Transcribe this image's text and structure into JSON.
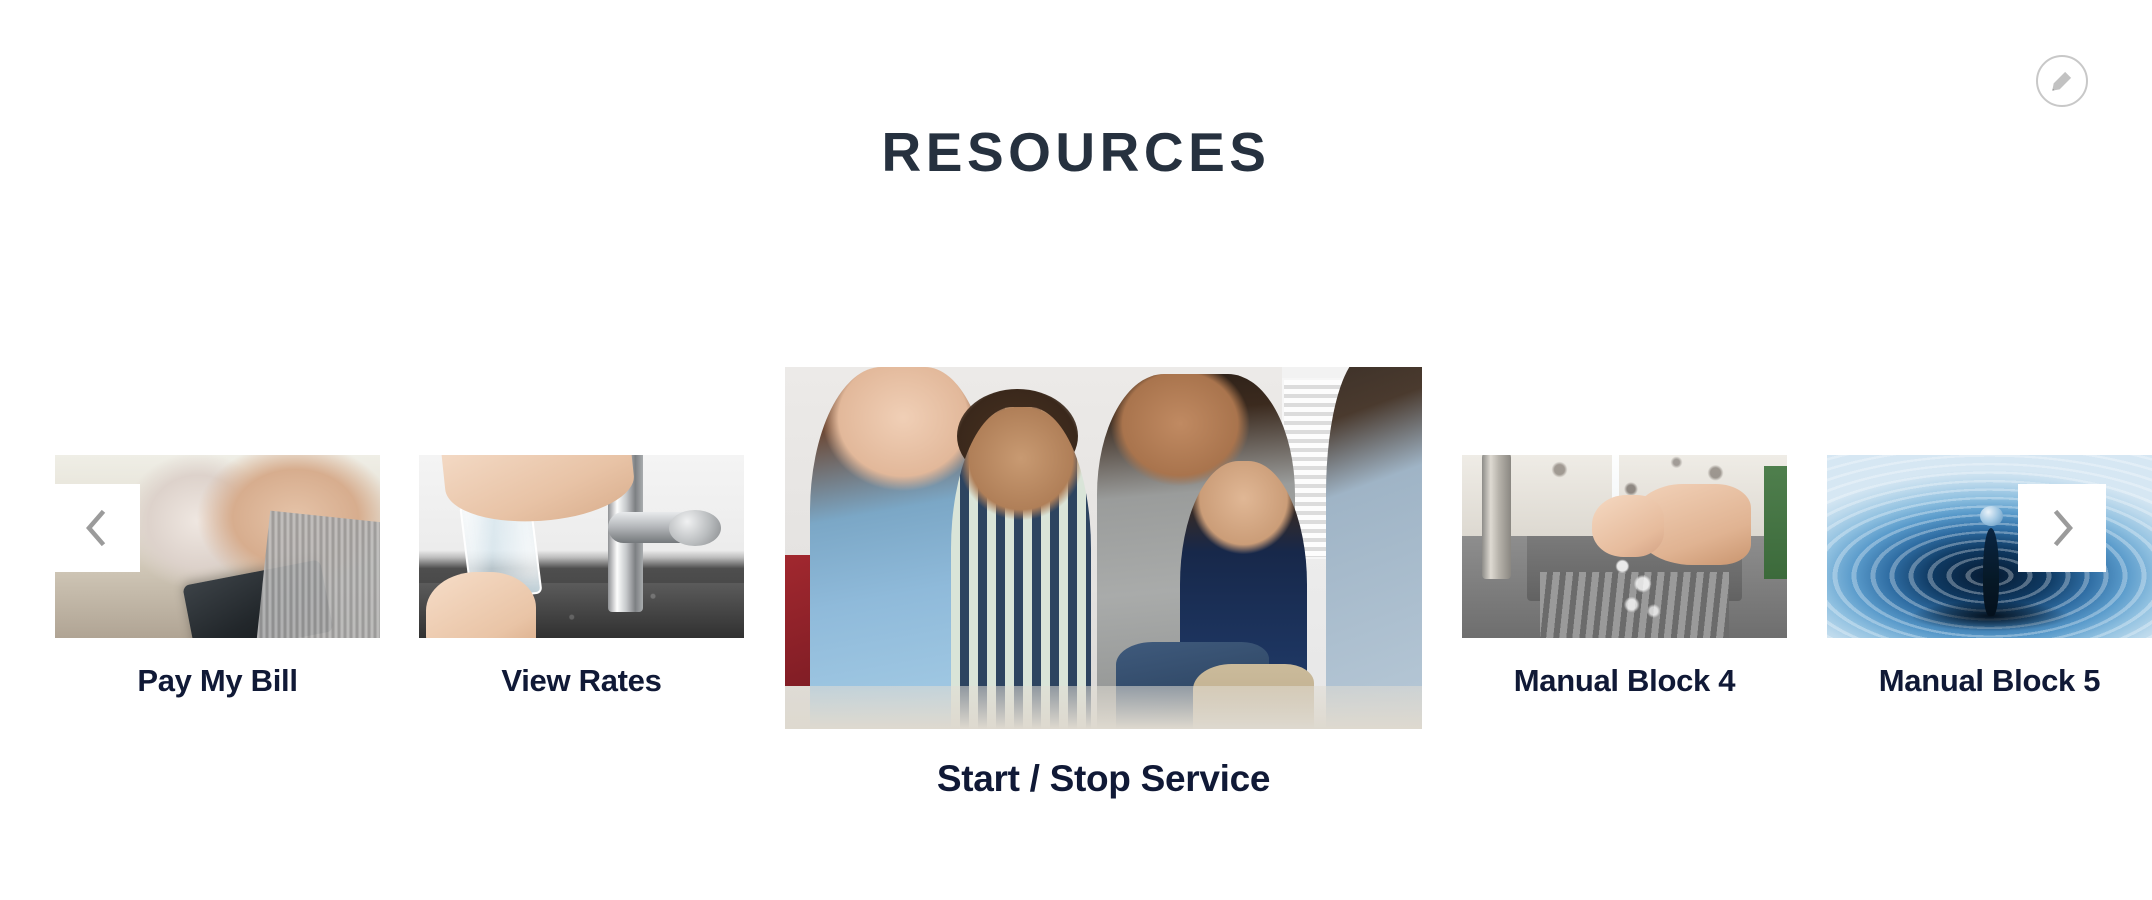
{
  "page": {
    "background_color": "#ffffff",
    "title_color": "#26313f",
    "card_label_color": "#101936",
    "arrow_color": "#9b9b9b"
  },
  "header": {
    "title": "RESOURCES"
  },
  "edit_button": {
    "icon": "pencil-icon",
    "border_color": "#c8c8c8",
    "icon_color": "#c2c2c2"
  },
  "carousel": {
    "prev_label": "‹",
    "next_label": "›",
    "prev_icon": "chevron-left-icon",
    "next_icon": "chevron-right-icon",
    "cards": [
      {
        "label": "Pay My Bill",
        "image_alt": "Senior couple smiling while using a tablet at a table",
        "variant": "side"
      },
      {
        "label": "View Rates",
        "image_alt": "Hand filling a clear glass with water from a chrome kitchen faucet",
        "variant": "side"
      },
      {
        "label": "Start / Stop Service",
        "image_alt": "Smiling family of four sitting together on a couch",
        "variant": "center"
      },
      {
        "label": "Manual Block 4",
        "image_alt": "Hands being washed under running water in a stainless steel sink",
        "variant": "side"
      },
      {
        "label": "Manual Block 5",
        "image_alt": "Blue water droplet creating concentric ripples",
        "variant": "side"
      }
    ]
  }
}
